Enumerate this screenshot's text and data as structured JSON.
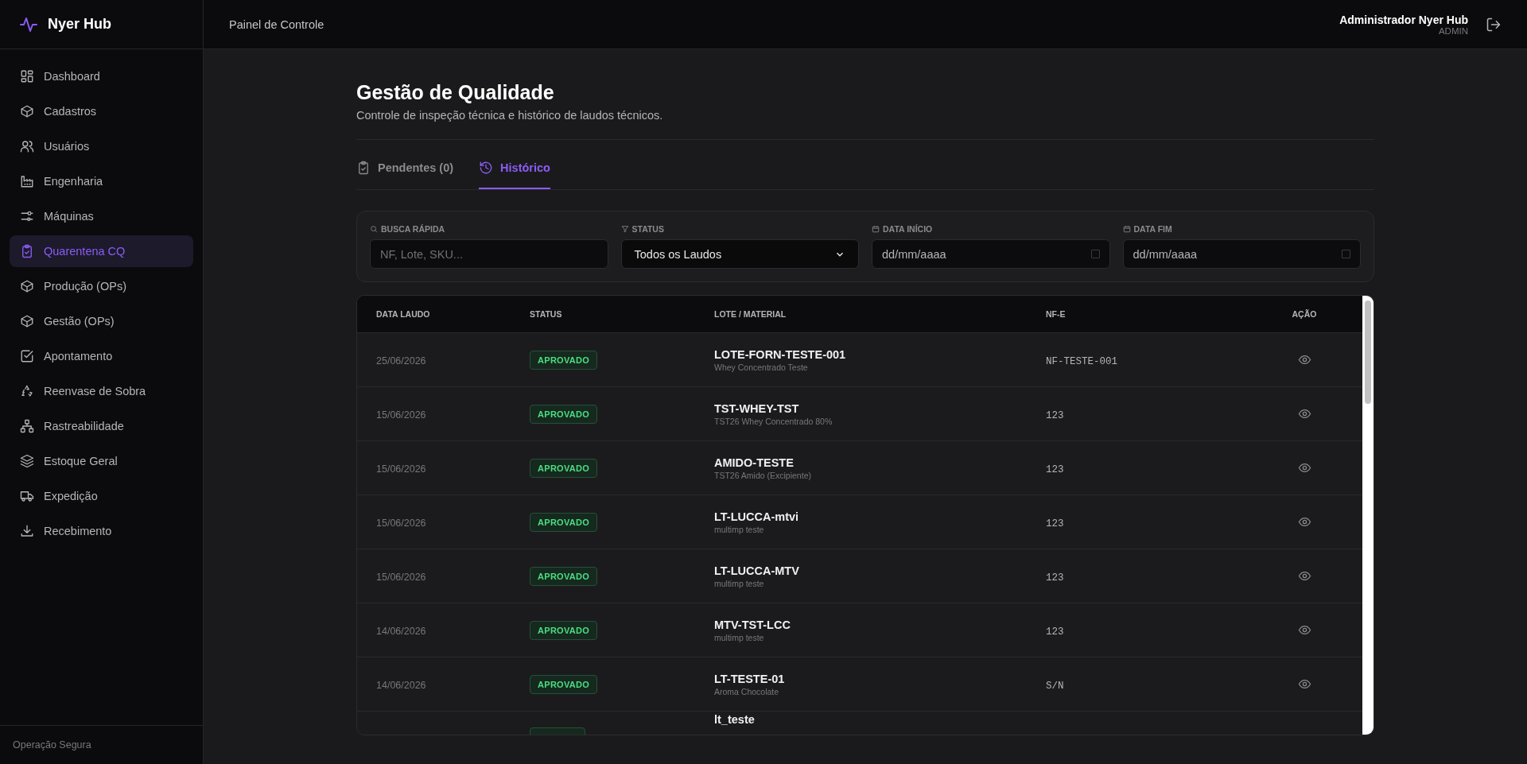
{
  "sidebar": {
    "brand": "Nyer Hub",
    "items": [
      {
        "label": "Dashboard",
        "selected": false
      },
      {
        "label": "Cadastros",
        "selected": false
      },
      {
        "label": "Usuários",
        "selected": false
      },
      {
        "label": "Engenharia",
        "selected": false
      },
      {
        "label": "Máquinas",
        "selected": false
      },
      {
        "label": "Quarentena CQ",
        "selected": true
      },
      {
        "label": "Produção (OPs)",
        "selected": false
      },
      {
        "label": "Gestão (OPs)",
        "selected": false
      },
      {
        "label": "Apontamento",
        "selected": false
      },
      {
        "label": "Reenvase de Sobra",
        "selected": false
      },
      {
        "label": "Rastreabilidade",
        "selected": false
      },
      {
        "label": "Estoque Geral",
        "selected": false
      },
      {
        "label": "Expedição",
        "selected": false
      },
      {
        "label": "Recebimento",
        "selected": false
      }
    ],
    "footer": "Operação Segura"
  },
  "header": {
    "title": "Painel de Controle",
    "user_name": "Administrador Nyer Hub",
    "user_role": "ADMIN"
  },
  "page": {
    "title": "Gestão de Qualidade",
    "subtitle": "Controle de inspeção técnica e histórico de laudos técnicos."
  },
  "tabs": [
    {
      "label": "Pendentes (0)",
      "selected": false
    },
    {
      "label": "Histórico",
      "selected": true
    }
  ],
  "filters": [
    {
      "kind": "text",
      "label": "BUSCA RÁPIDA",
      "placeholder": "NF, Lote, SKU..."
    },
    {
      "kind": "select",
      "label": "STATUS",
      "value": "Todos os Laudos"
    },
    {
      "kind": "date",
      "label": "DATA INÍCIO",
      "placeholder": "dd/mm/aaaa"
    },
    {
      "kind": "date",
      "label": "DATA FIM",
      "placeholder": "dd/mm/aaaa"
    }
  ],
  "table": {
    "columns": [
      "DATA LAUDO",
      "STATUS",
      "LOTE / MATERIAL",
      "NF-E",
      "AÇÃO"
    ],
    "rows": [
      {
        "date": "25/06/2026",
        "status": "APROVADO",
        "lot": "LOTE-FORN-TESTE-001",
        "material": "Whey Concentrado Teste",
        "nf": "NF-TESTE-001"
      },
      {
        "date": "15/06/2026",
        "status": "APROVADO",
        "lot": "TST-WHEY-TST",
        "material": "TST26 Whey Concentrado 80%",
        "nf": "123"
      },
      {
        "date": "15/06/2026",
        "status": "APROVADO",
        "lot": "AMIDO-TESTE",
        "material": "TST26 Amido (Excipiente)",
        "nf": "123"
      },
      {
        "date": "15/06/2026",
        "status": "APROVADO",
        "lot": "LT-LUCCA-mtvi",
        "material": "multimp teste",
        "nf": "123"
      },
      {
        "date": "15/06/2026",
        "status": "APROVADO",
        "lot": "LT-LUCCA-MTV",
        "material": "multimp teste",
        "nf": "123"
      },
      {
        "date": "14/06/2026",
        "status": "APROVADO",
        "lot": "MTV-TST-LCC",
        "material": "multimp teste",
        "nf": "123"
      },
      {
        "date": "14/06/2026",
        "status": "APROVADO",
        "lot": "LT-TESTE-01",
        "material": "Aroma Chocolate",
        "nf": "S/N"
      },
      {
        "lot": "lt_teste"
      }
    ]
  }
}
